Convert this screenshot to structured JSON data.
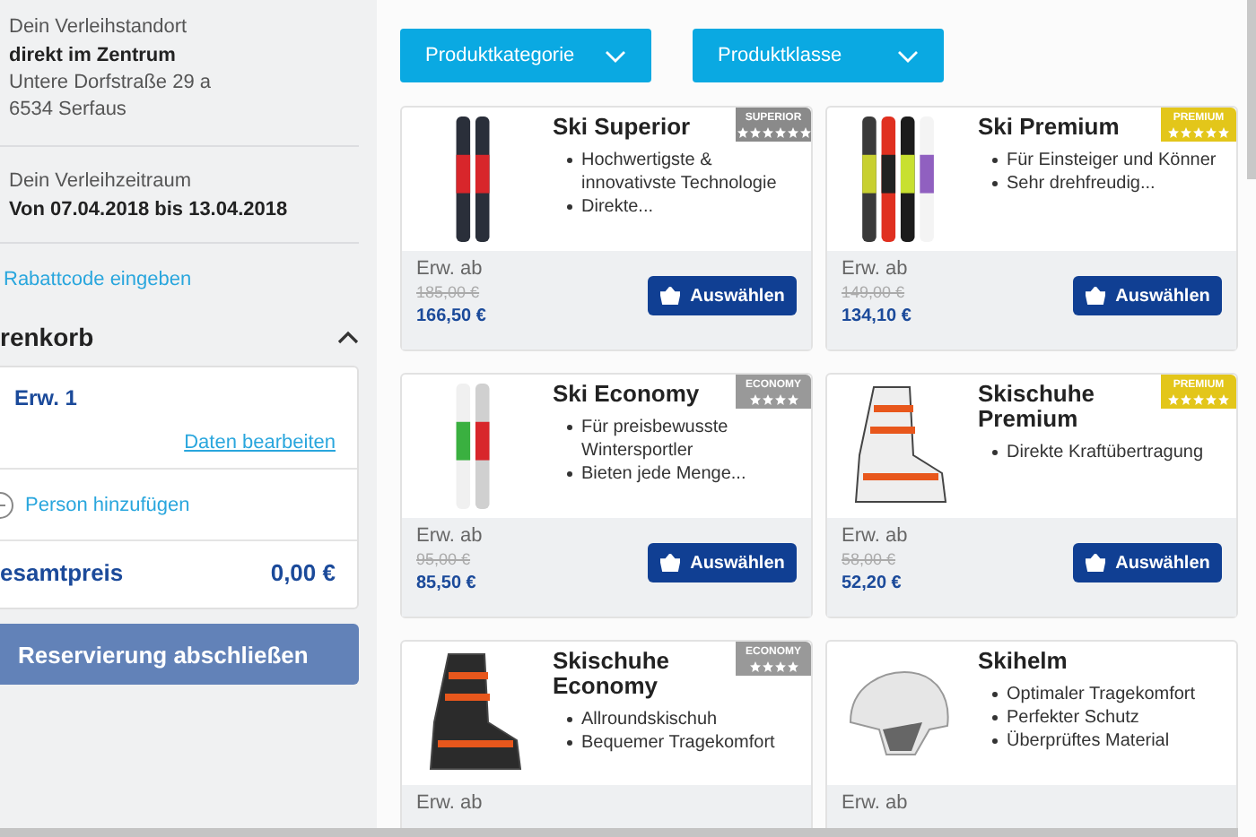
{
  "sidebar": {
    "location": {
      "label": "Dein Verleihstandort",
      "name": "direkt im Zentrum",
      "address": [
        "Untere Dorfstraße 29 a",
        "6534 Serfaus"
      ]
    },
    "period": {
      "label": "Dein Verleihzeitraum",
      "value": "Von 07.04.2018 bis 13.04.2018"
    },
    "coupon_link": "Rabattcode eingeben",
    "cart": {
      "title": "renkorb",
      "expanded": true,
      "person": "Erw. 1",
      "edit_link": "Daten bearbeiten",
      "add_person": "Person hinzufügen",
      "total_label": "esamtpreis",
      "total_value": "0,00 €"
    },
    "submit_button": "Reservierung abschließen"
  },
  "filters": [
    {
      "label": "Produktkategorie"
    },
    {
      "label": "Produktklasse"
    }
  ],
  "products": [
    {
      "title": "Ski Superior",
      "kind": "skis",
      "badge": {
        "kind": "superior",
        "label": "SUPERIOR",
        "stars": 6
      },
      "features": [
        "Hochwertigste & innovativste Technologie",
        "Direkte..."
      ],
      "price_label": "Erw. ab",
      "old_price": "185,00 €",
      "price": "166,50 €",
      "button": "Auswählen"
    },
    {
      "title": "Ski Premium",
      "kind": "skis",
      "badge": {
        "kind": "premium",
        "label": "PREMIUM",
        "stars": 5
      },
      "features": [
        "Für Einsteiger und Könner",
        "Sehr drehfreudig..."
      ],
      "price_label": "Erw. ab",
      "old_price": "149,00 €",
      "price": "134,10 €",
      "button": "Auswählen"
    },
    {
      "title": "Ski Economy",
      "kind": "skis",
      "badge": {
        "kind": "economy",
        "label": "ECONOMY",
        "stars": 4
      },
      "features": [
        "Für preisbewusste Wintersportler",
        "Bieten jede Menge..."
      ],
      "price_label": "Erw. ab",
      "old_price": "95,00 €",
      "price": "85,50 €",
      "button": "Auswählen"
    },
    {
      "title": "Skischuhe Premium",
      "kind": "boot",
      "badge": {
        "kind": "premium",
        "label": "PREMIUM",
        "stars": 5
      },
      "features": [
        "Direkte Kraftübertragung"
      ],
      "price_label": "Erw. ab",
      "old_price": "58,00 €",
      "price": "52,20 €",
      "button": "Auswählen"
    },
    {
      "title": "Skischuhe Economy",
      "kind": "boot",
      "badge": {
        "kind": "economy",
        "label": "ECONOMY",
        "stars": 4
      },
      "features": [
        "Allroundskischuh",
        "Bequemer Tragekomfort"
      ],
      "price_label": "Erw. ab"
    },
    {
      "title": "Skihelm",
      "kind": "helmet",
      "features": [
        "Optimaler Tragekomfort",
        "Perfekter Schutz",
        "Überprüftes Material"
      ],
      "price_label": "Erw. ab"
    }
  ]
}
